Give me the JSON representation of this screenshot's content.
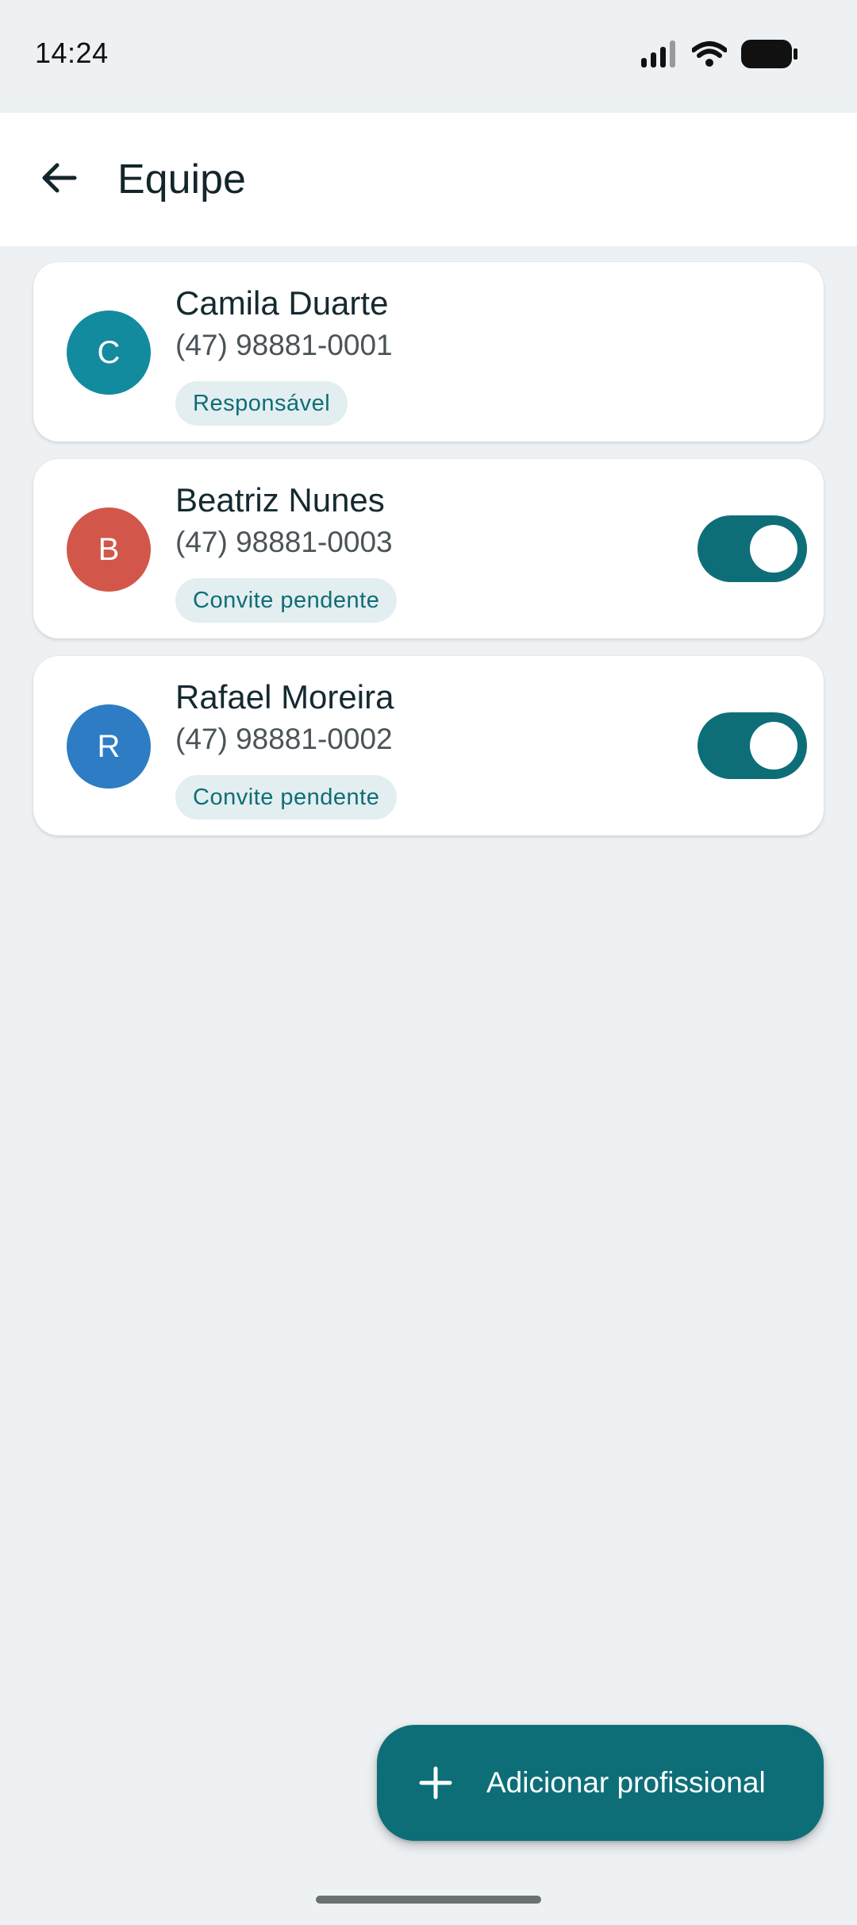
{
  "status_bar": {
    "time": "14:24",
    "icons": [
      "signal-icon",
      "wifi-icon",
      "battery-icon"
    ]
  },
  "app_bar": {
    "back_icon": "arrow-back-icon",
    "title": "Equipe"
  },
  "members": [
    {
      "initial": "C",
      "name": "Camila Duarte",
      "phone": "(47) 98881-0001",
      "badge": "Responsável",
      "avatar_color": "#138b9e",
      "has_toggle": false
    },
    {
      "initial": "B",
      "name": "Beatriz Nunes",
      "phone": "(47) 98881-0003",
      "badge": "Convite pendente",
      "avatar_color": "#d2574a",
      "has_toggle": true,
      "toggle_on": true
    },
    {
      "initial": "R",
      "name": "Rafael Moreira",
      "phone": "(47) 98881-0002",
      "badge": "Convite pendente",
      "avatar_color": "#2d7cc4",
      "has_toggle": true,
      "toggle_on": true
    }
  ],
  "fab": {
    "icon": "plus-icon",
    "label": "Adicionar profissional"
  },
  "colors": {
    "accent": "#0d6e78",
    "background": "#edf1f3",
    "badge_bg": "#e3eef0",
    "badge_text": "#0f6d76"
  }
}
